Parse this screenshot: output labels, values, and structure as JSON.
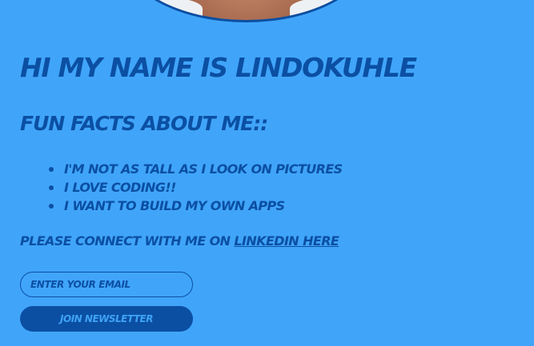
{
  "profile": {
    "avatar_icon": "profile-photo"
  },
  "intro": {
    "heading": "Hi my name is Lindokuhle",
    "subheading": "Fun facts about me::"
  },
  "facts": [
    "I'm not as tall as I look on pictures",
    "I love coding!!",
    "I want to build my own apps"
  ],
  "connect": {
    "text": "Please connect with me on ",
    "link_label": "LinkedIn here"
  },
  "newsletter": {
    "email_placeholder": "Enter your email",
    "email_value": "",
    "button_label": "Join newsletter"
  },
  "colors": {
    "background": "#40a5f9",
    "accent": "#0b4fa3"
  }
}
